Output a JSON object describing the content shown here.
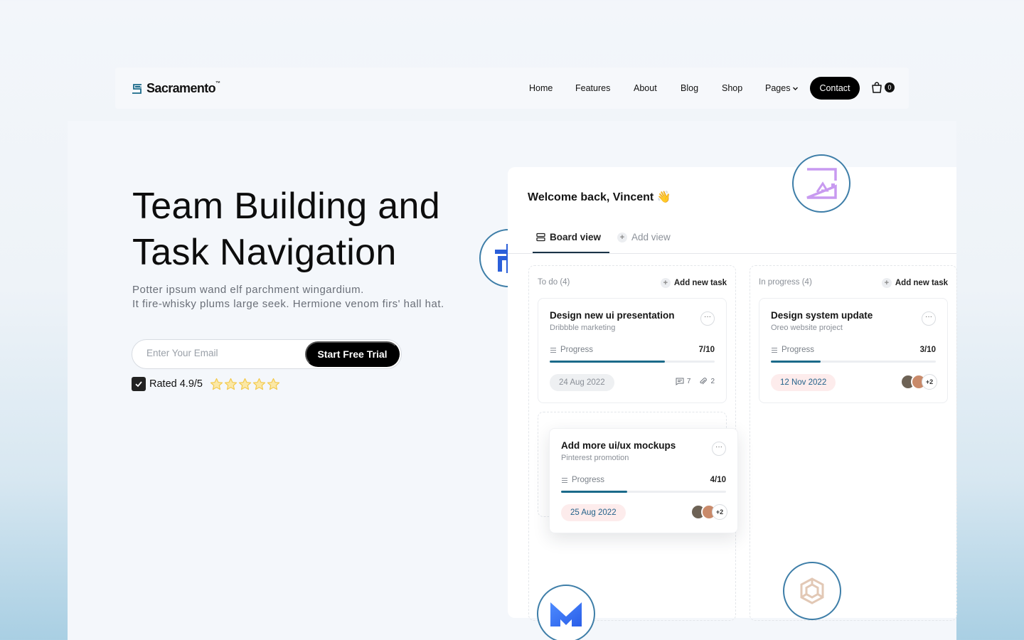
{
  "brand": {
    "name": "Sacramento",
    "tm": "™"
  },
  "nav": {
    "items": [
      "Home",
      "Features",
      "About",
      "Blog",
      "Shop",
      "Pages"
    ],
    "contact_label": "Contact",
    "cart_count": "0"
  },
  "hero": {
    "title_line1": "Team Building and",
    "title_line2": "Task Navigation",
    "desc_line1": "Potter ipsum wand elf parchment wingardium.",
    "desc_line2": "It fire-whisky plums large seek. Hermione venom firs' hall hat.",
    "email_placeholder": "Enter Your Email",
    "cta_label": "Start Free Trial",
    "rating_text": "Rated 4.9/5",
    "stars": 5
  },
  "dashboard": {
    "welcome": "Welcome back, Vincent",
    "welcome_emoji": "👋",
    "tab_board": "Board view",
    "tab_add": "Add view",
    "columns": [
      {
        "title": "To do (4)",
        "add_label": "Add new task",
        "cards": [
          {
            "title": "Design new ui presentation",
            "subtitle": "Dribbble marketing",
            "progress_label": "Progress",
            "progress_value": "7/10",
            "progress": 0.7,
            "date": "24 Aug 2022",
            "comments": "7",
            "attachments": "2"
          },
          {
            "title": "Add more ui/ux mockups",
            "subtitle": "Pinterest promotion",
            "progress_label": "Progress",
            "progress_value": "4/10",
            "progress": 0.4,
            "date": "25 Aug 2022",
            "avatars_more": "+2"
          }
        ]
      },
      {
        "title": "In progress (4)",
        "add_label": "Add new task",
        "cards": [
          {
            "title": "Design system update",
            "subtitle": "Oreo website project",
            "progress_label": "Progress",
            "progress_value": "3/10",
            "progress": 0.3,
            "date": "12 Nov 2022",
            "avatars_more": "+2"
          }
        ]
      }
    ]
  },
  "colors": {
    "accent_dark": "#000000",
    "progress_fill": "#1b6a8a",
    "circle_border": "#3e7ea8",
    "star": "#f3c94b"
  }
}
